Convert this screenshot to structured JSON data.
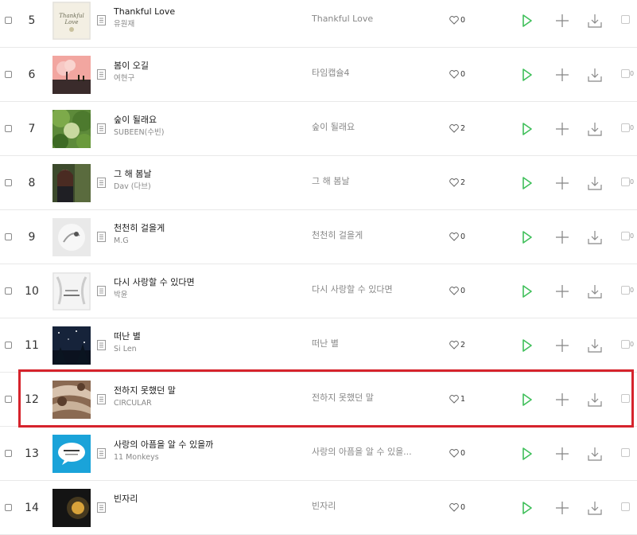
{
  "colors": {
    "play": "#3fbf5a",
    "highlight": "#d6232c",
    "icon_gray": "#999999"
  },
  "icons": {
    "info": "info-doc-icon",
    "like": "heart-icon",
    "play": "play-icon",
    "add": "plus-icon",
    "download": "download-icon",
    "more": "more-box-icon"
  },
  "songs": [
    {
      "rank": "5",
      "title": "Thankful Love",
      "artist": "유원재",
      "album": "Thankful Love",
      "likes": "0",
      "more": ""
    },
    {
      "rank": "6",
      "title": "봄이 오길",
      "artist": "여현구",
      "album": "타임캡슐4",
      "likes": "0",
      "more": "0"
    },
    {
      "rank": "7",
      "title": "숲이 될래요",
      "artist": "SUBEEN(수빈)",
      "album": "숲이 될래요",
      "likes": "2",
      "more": "0"
    },
    {
      "rank": "8",
      "title": "그 해 봄날",
      "artist": "Dav (다브)",
      "album": "그 해 봄날",
      "likes": "2",
      "more": "0"
    },
    {
      "rank": "9",
      "title": "천천히 걸을게",
      "artist": "M.G",
      "album": "천천히 걸을게",
      "likes": "0",
      "more": "0"
    },
    {
      "rank": "10",
      "title": "다시 사랑할 수 있다면",
      "artist": "박윤",
      "album": "다시 사랑할 수 있다면",
      "likes": "0",
      "more": "0"
    },
    {
      "rank": "11",
      "title": "떠난 별",
      "artist": "Si Len",
      "album": "떠난 별",
      "likes": "2",
      "more": "0"
    },
    {
      "rank": "12",
      "title": "전하지 못했던 말",
      "artist": "CIRCULAR",
      "album": "전하지 못했던 말",
      "likes": "1",
      "more": ""
    },
    {
      "rank": "13",
      "title": "사랑의 아픔을 알 수 있을까",
      "artist": "11 Monkeys",
      "album": "사랑의 아픔을 알 수 있을...",
      "likes": "0",
      "more": ""
    },
    {
      "rank": "14",
      "title": "빈자리",
      "artist": "",
      "album": "빈자리",
      "likes": "0",
      "more": ""
    }
  ]
}
